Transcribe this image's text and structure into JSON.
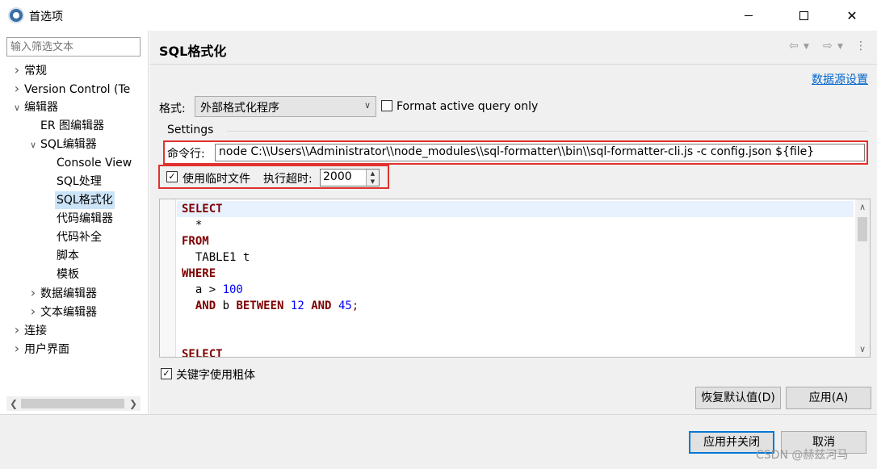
{
  "window": {
    "title": "首选项",
    "controls": {
      "minimize": "minimize",
      "maximize": "maximize",
      "close": "✕"
    }
  },
  "sidebar": {
    "filter_placeholder": "输入筛选文本",
    "items": [
      {
        "label": "常规",
        "level": 0,
        "expanded": false,
        "has_children": true
      },
      {
        "label": "Version Control (Te",
        "level": 0,
        "expanded": false,
        "has_children": true
      },
      {
        "label": "编辑器",
        "level": 0,
        "expanded": true,
        "has_children": true
      },
      {
        "label": "ER 图编辑器",
        "level": 1,
        "expanded": false,
        "has_children": false
      },
      {
        "label": "SQL编辑器",
        "level": 1,
        "expanded": true,
        "has_children": true
      },
      {
        "label": "Console View",
        "level": 2,
        "expanded": false,
        "has_children": false
      },
      {
        "label": "SQL处理",
        "level": 2,
        "expanded": false,
        "has_children": false
      },
      {
        "label": "SQL格式化",
        "level": 2,
        "expanded": false,
        "has_children": false,
        "selected": true
      },
      {
        "label": "代码编辑器",
        "level": 2,
        "expanded": false,
        "has_children": false
      },
      {
        "label": "代码补全",
        "level": 2,
        "expanded": false,
        "has_children": false
      },
      {
        "label": "脚本",
        "level": 2,
        "expanded": false,
        "has_children": false
      },
      {
        "label": "模板",
        "level": 2,
        "expanded": false,
        "has_children": false
      },
      {
        "label": "数据编辑器",
        "level": 1,
        "expanded": false,
        "has_children": true
      },
      {
        "label": "文本编辑器",
        "level": 1,
        "expanded": false,
        "has_children": true
      },
      {
        "label": "连接",
        "level": 0,
        "expanded": false,
        "has_children": true
      },
      {
        "label": "用户界面",
        "level": 0,
        "expanded": false,
        "has_children": true
      }
    ]
  },
  "page": {
    "title": "SQL格式化",
    "datasource_link": "数据源设置",
    "format_label": "格式:",
    "format_value": "外部格式化程序",
    "format_active_only": {
      "label": "Format active query only",
      "checked": false
    },
    "settings_group": "Settings",
    "command_label": "命令行:",
    "command_value": "node C:\\\\Users\\\\Administrator\\\\node_modules\\\\sql-formatter\\\\bin\\\\sql-formatter-cli.js -c config.json ${file}",
    "use_temp_file": {
      "label": "使用临时文件",
      "checked": true
    },
    "timeout_label": "执行超时:",
    "timeout_value": "2000",
    "bold_keywords": {
      "label": "关键字使用粗体",
      "checked": true
    },
    "preview_lines": [
      {
        "tokens": [
          {
            "t": "SELECT",
            "k": "kw"
          }
        ]
      },
      {
        "tokens": [
          {
            "t": "  *",
            "k": "op"
          }
        ]
      },
      {
        "tokens": [
          {
            "t": "FROM",
            "k": "kw"
          }
        ]
      },
      {
        "tokens": [
          {
            "t": "  TABLE1 t",
            "k": "op"
          }
        ]
      },
      {
        "tokens": [
          {
            "t": "WHERE",
            "k": "kw"
          }
        ]
      },
      {
        "tokens": [
          {
            "t": "  a > ",
            "k": "op"
          },
          {
            "t": "100",
            "k": "num"
          }
        ]
      },
      {
        "tokens": [
          {
            "t": "  ",
            "k": "op"
          },
          {
            "t": "AND",
            "k": "kw"
          },
          {
            "t": " b ",
            "k": "op"
          },
          {
            "t": "BETWEEN",
            "k": "kw"
          },
          {
            "t": " ",
            "k": "op"
          },
          {
            "t": "12",
            "k": "num"
          },
          {
            "t": " ",
            "k": "op"
          },
          {
            "t": "AND",
            "k": "kw"
          },
          {
            "t": " ",
            "k": "op"
          },
          {
            "t": "45",
            "k": "num"
          },
          {
            "t": ";",
            "k": "kw-plain"
          }
        ]
      },
      {
        "tokens": []
      },
      {
        "tokens": []
      },
      {
        "tokens": [
          {
            "t": "SELECT",
            "k": "kw"
          }
        ]
      }
    ],
    "restore_defaults_button": "恢复默认值(D)",
    "apply_button": "应用(A)"
  },
  "footer": {
    "apply_close_button": "应用并关闭",
    "cancel_button": "取消",
    "watermark": "CSDN @赫兹河马"
  },
  "colors": {
    "keyword": "#7f0000",
    "number": "#0000ff",
    "highlight_box": "#e0312d",
    "link": "#0066cc",
    "selection": "#cce4f7"
  }
}
